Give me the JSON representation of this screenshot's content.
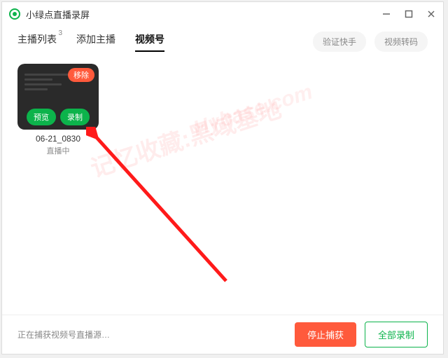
{
  "titlebar": {
    "app_name": "小绿点直播录屏"
  },
  "tabs": {
    "items": [
      {
        "label": "主播列表",
        "badge": "3"
      },
      {
        "label": "添加主播"
      },
      {
        "label": "视频号"
      }
    ],
    "active_index": 2
  },
  "right_buttons": {
    "verify": "验证快手",
    "transcode": "视频转码"
  },
  "card": {
    "remove_label": "移除",
    "preview_label": "预览",
    "record_label": "录制",
    "name": "06-21_0830",
    "status": "直播中"
  },
  "watermark": {
    "line1": "记忆收藏:黑域基地",
    "line2": "Hybase.com"
  },
  "footer": {
    "status": "正在捕获视频号直播源…",
    "stop_label": "停止捕获",
    "record_all_label": "全部录制"
  }
}
